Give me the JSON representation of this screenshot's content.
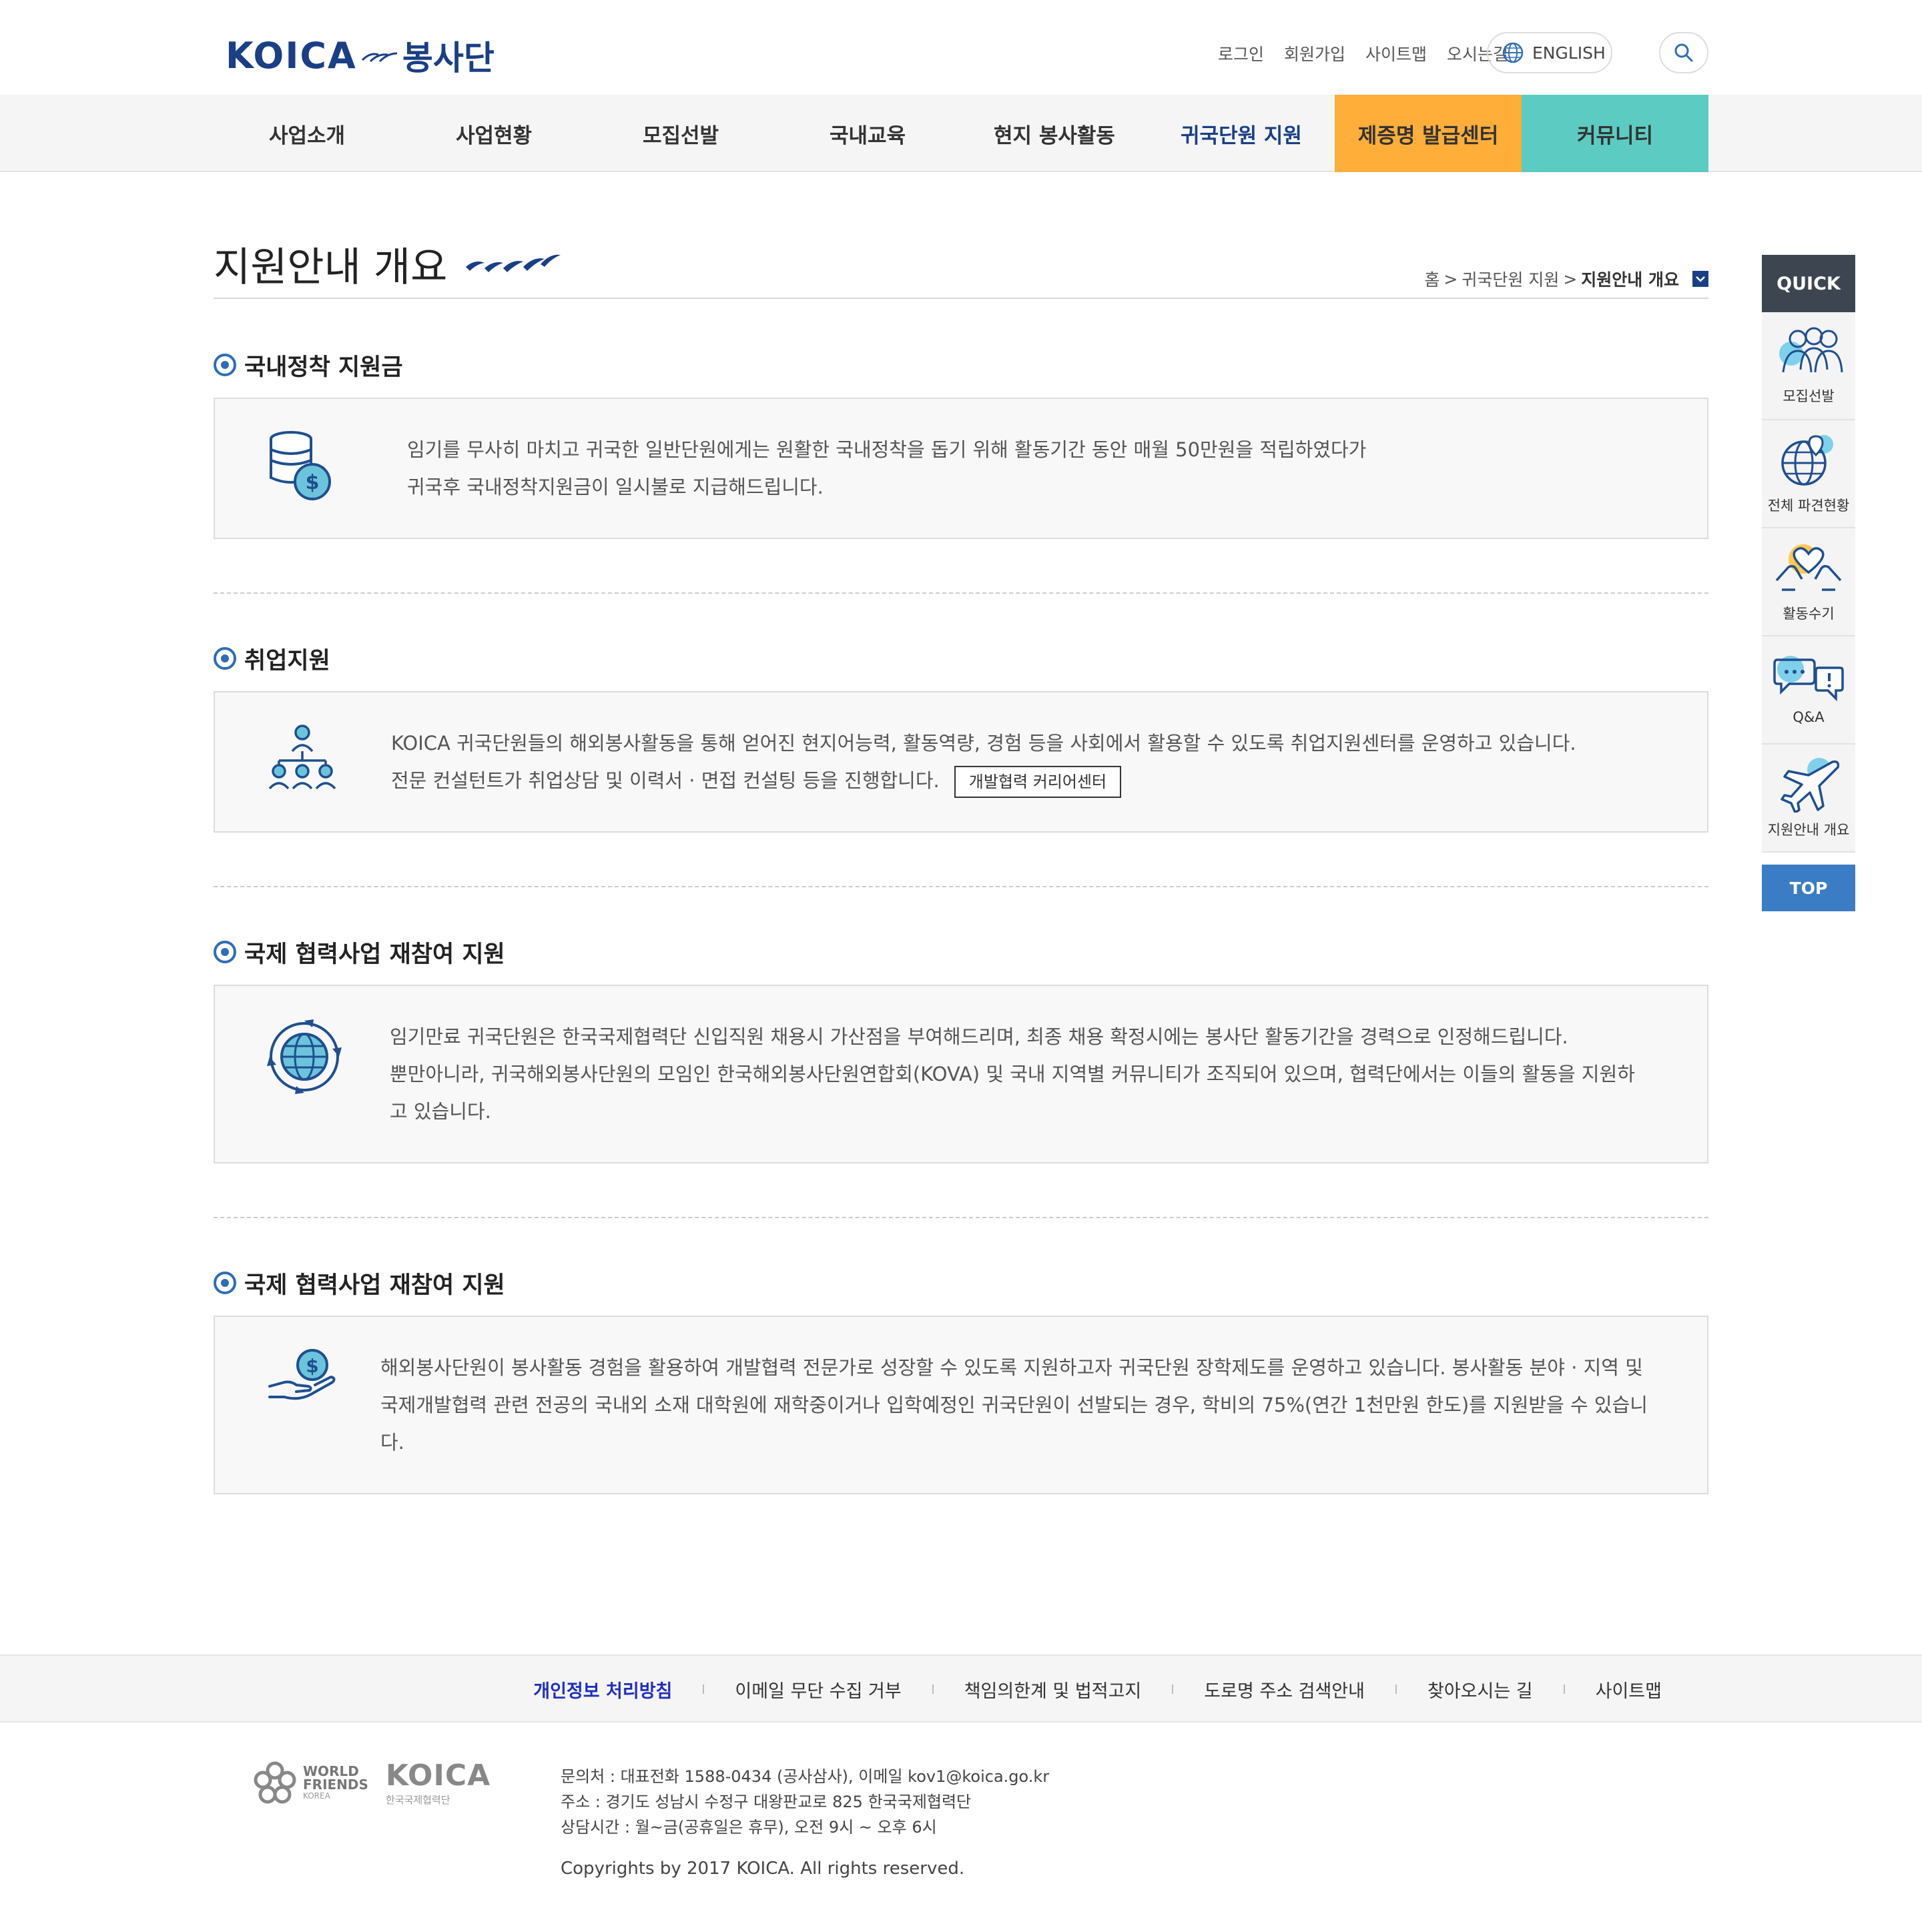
{
  "header": {
    "logo_text": "KOICA",
    "logo_suffix": "봉사단",
    "util_links": [
      "로그인",
      "회원가입",
      "사이트맵",
      "오시는길"
    ],
    "english_label": "ENGLISH"
  },
  "gnb": [
    "사업소개",
    "사업현황",
    "모집선발",
    "국내교육",
    "현지 봉사활동",
    "귀국단원 지원",
    "제증명 발급센터",
    "커뮤니티"
  ],
  "page": {
    "title": "지원안내 개요",
    "breadcrumb": [
      "홈",
      "귀국단원 지원",
      "지원안내 개요"
    ]
  },
  "sections": [
    {
      "title": "국내정착 지원금",
      "icon": "coins-dollar-icon",
      "lines": [
        "임기를 무사히 마치고 귀국한 일반단원에게는 원활한 국내정착을 돕기 위해 활동기간 동안 매월 50만원을 적립하였다가",
        "귀국후 국내정착지원금이 일시불로 지급해드립니다."
      ]
    },
    {
      "title": "취업지원",
      "icon": "network-people-icon",
      "lines": [
        "KOICA 귀국단원들의 해외봉사활동을 통해 얻어진 현지어능력, 활동역량, 경험 등을 사회에서 활용할 수 있도록 취업지원센터를 운영하고 있습니다.",
        "전문 컨설턴트가 취업상담 및 이력서 · 면접 컨설팅 등을 진행합니다."
      ],
      "button": "개발협력 커리어센터"
    },
    {
      "title": "국제 협력사업 재참여 지원",
      "icon": "globe-cycle-icon",
      "lines": [
        "임기만료 귀국단원은 한국국제협력단 신입직원 채용시 가산점을 부여해드리며, 최종 채용 확정시에는 봉사단 활동기간을 경력으로 인정해드립니다.",
        "뿐만아니라, 귀국해외봉사단원의 모임인 한국해외봉사단원연합회(KOVA) 및 국내 지역별 커뮤니티가 조직되어 있으며, 협력단에서는 이들의 활동을 지원하",
        "고 있습니다."
      ]
    },
    {
      "title": "국제 협력사업 재참여 지원",
      "icon": "hand-coin-icon",
      "lines": [
        "해외봉사단원이 봉사활동 경험을 활용하여 개발협력 전문가로 성장할 수 있도록 지원하고자 귀국단원 장학제도를 운영하고 있습니다. 봉사활동 분야 · 지역 및",
        "국제개발협력 관련 전공의 국내외 소재 대학원에 재학중이거나 입학예정인 귀국단원이 선발되는 경우, 학비의 75%(연간 1천만원 한도)를 지원받을 수 있습니",
        "다."
      ]
    }
  ],
  "quick": {
    "head": "QUICK",
    "items": [
      {
        "label": "모집선발",
        "icon": "people-group-icon"
      },
      {
        "label": "전체 파견현황",
        "icon": "globe-pin-icon"
      },
      {
        "label": "활동수기",
        "icon": "heart-hands-icon"
      },
      {
        "label": "Q&A",
        "icon": "chat-bubbles-icon"
      },
      {
        "label": "지원안내 개요",
        "icon": "airplane-icon"
      }
    ],
    "top": "TOP"
  },
  "footer": {
    "links": [
      "개인정보 처리방침",
      "이메일 무단 수집 거부",
      "책임의한계 및 법적고지",
      "도로명 주소 검색안내",
      "찾아오시는 길",
      "사이트맵"
    ],
    "logo_wf": [
      "WORLD",
      "FRIENDS",
      "KOREA"
    ],
    "logo_koica": "KOICA",
    "logo_koica_sub": "한국국제협력단",
    "info": [
      "문의처 : 대표전화 1588-0434 (공사삼사), 이메일 kov1@koica.go.kr",
      "주소 : 경기도 성남시 수정구 대왕판교로 825 한국국제협력단",
      "상담시간 : 월~금(공휴일은 휴무), 오전 9시 ~ 오후 6시"
    ],
    "copyright": "Copyrights by 2017 KOICA. All rights reserved."
  },
  "colors": {
    "brand_navy": "#1a3f87",
    "accent_blue": "#2f6db5",
    "orange": "#ffae3a",
    "teal": "#5cccc2",
    "quick_head": "#3d4650",
    "top_button": "#3b7dc4"
  }
}
